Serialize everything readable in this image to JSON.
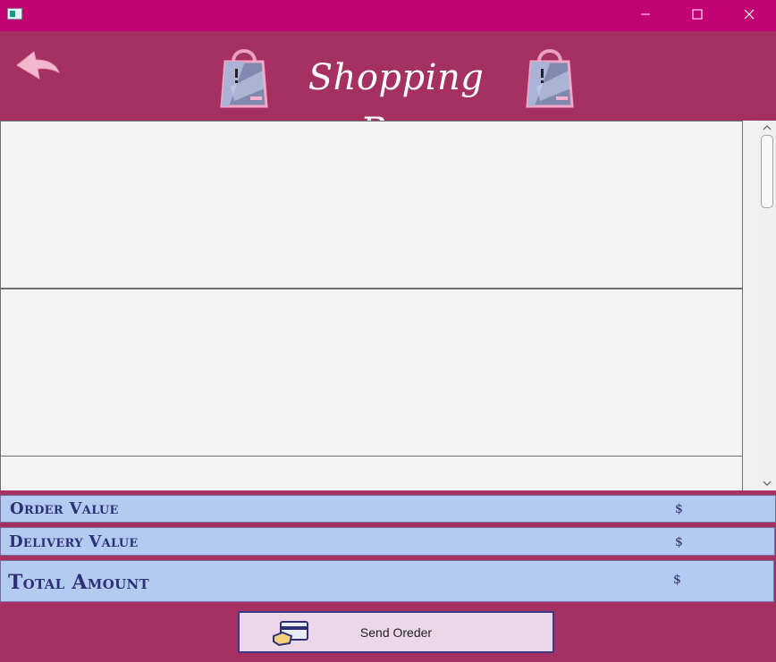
{
  "window": {
    "controls": {
      "minimize_icon": "minimize-icon",
      "maximize_icon": "maximize-icon",
      "close_icon": "close-icon"
    }
  },
  "header": {
    "title": "Shopping Bag",
    "back_icon": "back-arrow-icon",
    "bag_icon": "shopping-bag-icon"
  },
  "colors": {
    "titlebar": "#c20175",
    "background": "#a43161",
    "summary_bg": "#b3cbf1",
    "summary_text": "#2e3077",
    "button_bg": "#ecd7e8"
  },
  "summary": {
    "order_label": "Order Value",
    "order_value": "$",
    "delivery_label": "Delivery Value",
    "delivery_value": "$",
    "total_label": "Total Amount",
    "total_value": "$"
  },
  "actions": {
    "send_label": "Send Oreder",
    "send_icon": "credit-card-icon"
  }
}
